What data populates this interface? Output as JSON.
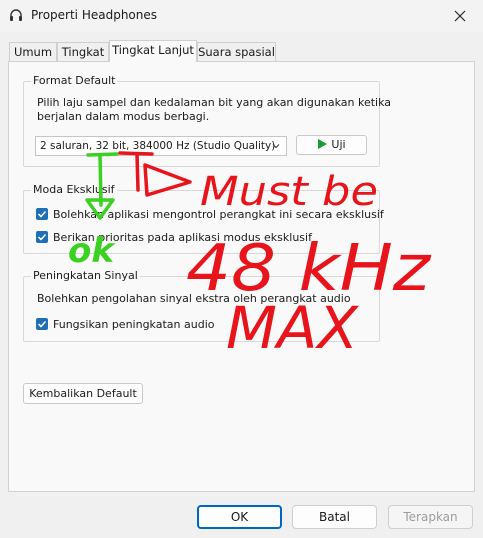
{
  "window": {
    "title": "Properti Headphones",
    "close_icon": "close-icon",
    "app_icon": "headphones-icon"
  },
  "tabs": [
    {
      "label": "Umum"
    },
    {
      "label": "Tingkat"
    },
    {
      "label": "Tingkat Lanjut",
      "active": true
    },
    {
      "label": "Suara spasial"
    }
  ],
  "format_default": {
    "title": "Format Default",
    "description_line1": "Pilih laju sampel dan kedalaman bit yang akan digunakan ketika",
    "description_line2": "berjalan dalam modus berbagi.",
    "selected_format": "2 saluran, 32 bit, 384000 Hz (Studio Quality)",
    "test_button": "Uji"
  },
  "exclusive_mode": {
    "title": "Moda Eksklusif",
    "option1": "Bolehkan aplikasi mengontrol perangkat ini secara eksklusif",
    "option2": "Berikan prioritas pada aplikasi modus eksklusif",
    "option1_checked": true,
    "option2_checked": true
  },
  "signal_enhancement": {
    "title": "Peningkatan Sinyal",
    "description": "Bolehkan pengolahan sinyal ekstra oleh perangkat audio",
    "option": "Fungsikan peningkatan audio",
    "option_checked": true
  },
  "restore_default_button": "Kembalikan Default",
  "dialog_buttons": {
    "ok": "OK",
    "cancel": "Batal",
    "apply": "Terapkan"
  },
  "annotations": {
    "red_text_line1": "Must be",
    "red_text_line2": "48 kHz",
    "red_text_line3": "MAX",
    "green_text": "ok",
    "red_color": "#e8141b",
    "green_color": "#3ad121"
  }
}
